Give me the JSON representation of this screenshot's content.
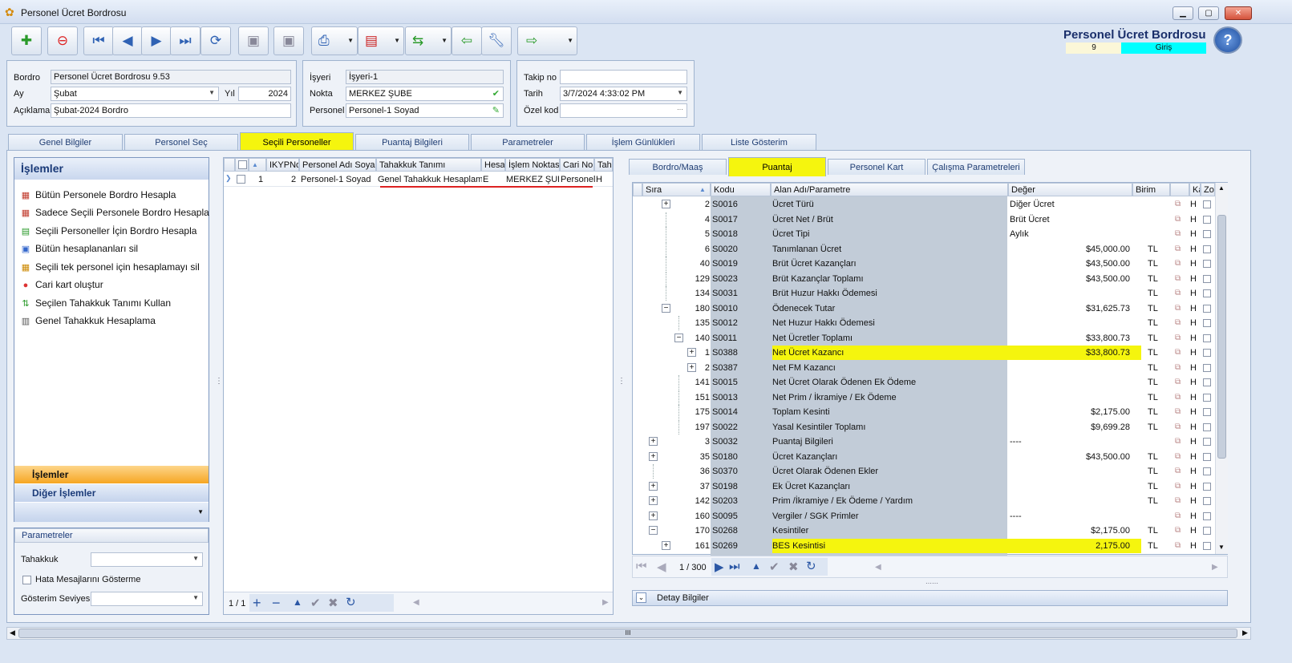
{
  "window": {
    "title": "Personel Ücret Bordrosu",
    "min": "▁",
    "max": "▢",
    "close": "✕"
  },
  "header": {
    "title": "Personel Ücret Bordrosu",
    "record_no": "9",
    "mode": "Giriş",
    "help": "?"
  },
  "colors": {
    "accent": "#f5f50e",
    "brand": "#1a2f6b",
    "mode_bg": "#00ffff"
  },
  "form": {
    "bordro_label": "Bordro",
    "bordro_value": "Personel Ücret Bordrosu 9.53",
    "ay_label": "Ay",
    "ay_value": "Şubat",
    "yil_label": "Yıl",
    "yil_value": "2024",
    "aciklama_label": "Açıklama",
    "aciklama_value": "Şubat-2024 Bordro",
    "isyeri_label": "İşyeri",
    "isyeri_value": "İşyeri-1",
    "nokta_label": "Nokta",
    "nokta_value": "MERKEZ ŞUBE",
    "personel_label": "Personel",
    "personel_value": "Personel-1 Soyad",
    "takip_label": "Takip no",
    "takip_value": "",
    "tarih_label": "Tarih",
    "tarih_value": "3/7/2024 4:33:02 PM",
    "ozel_label": "Özel kod",
    "ozel_value": "",
    "ellipsis": "···"
  },
  "tabs": [
    "Genel Bilgiler",
    "Personel Seç",
    "Seçili Personeller",
    "Puantaj Bilgileri",
    "Parametreler",
    "İşlem Günlükleri",
    "Liste Gösterim"
  ],
  "ops": {
    "title": "İşlemler",
    "items": [
      "Bütün Personele Bordro Hesapla",
      "Sadece Seçili Personele Bordro Hesapla",
      "Seçili Personeller İçin Bordro Hesapla",
      "Bütün hesaplananları sil",
      "Seçili tek personel için hesaplamayı sil",
      "Cari kart oluştur",
      "Seçilen Tahakkuk Tanımı Kullan",
      "Genel Tahakkuk Hesaplama"
    ],
    "group_active": "İşlemler",
    "group_other": "Diğer İşlemler",
    "params_title": "Parametreler",
    "tahakkuk_label": "Tahakkuk",
    "hata_label": "Hata Mesajlarını Gösterme",
    "gosterim_label": "Gösterim Seviyesi"
  },
  "grid": {
    "columns": [
      "IKYPNo",
      "Personel Adı Soyadı",
      "Tahakkuk Tanımı",
      "Hesap",
      "İşlem Noktası",
      "Cari No",
      "Tah"
    ],
    "row": {
      "idx": "1",
      "ikyp": "2",
      "name": "Personel-1 Soyad",
      "tanim": "Genel Tahakkuk Hesaplama",
      "hesap": "E",
      "nokta": "MERKEZ ŞUBE",
      "cari": "Personel",
      "tah": "H"
    },
    "pager": "1 / 1"
  },
  "subtabs": [
    "Bordro/Maaş",
    "Puantaj",
    "Personel Kart",
    "Çalışma Parametreleri"
  ],
  "tree": {
    "columns": [
      "Sıra",
      "Kodu",
      "Alan Adı/Parametre",
      "Değer",
      "Birim",
      "Ka",
      "Zor"
    ],
    "rows": [
      {
        "exp": "+",
        "sira": "2",
        "kod": "S0016",
        "ad": "Ücret Türü",
        "deger": "Diğer Ücret",
        "birim": "",
        "h": "H",
        "lvl": 1
      },
      {
        "exp": "",
        "sira": "4",
        "kod": "S0017",
        "ad": "Ücret Net / Brüt",
        "deger": "Brüt Ücret",
        "birim": "",
        "h": "H",
        "lvl": 1
      },
      {
        "exp": "",
        "sira": "5",
        "kod": "S0018",
        "ad": "Ücret Tipi",
        "deger": "Aylık",
        "birim": "",
        "h": "H",
        "lvl": 1
      },
      {
        "exp": "",
        "sira": "6",
        "kod": "S0020",
        "ad": "Tanımlanan Ücret",
        "deger": "$45,000.00",
        "birim": "TL",
        "h": "H",
        "lvl": 1
      },
      {
        "exp": "",
        "sira": "40",
        "kod": "S0019",
        "ad": "Brüt Ücret Kazançları",
        "deger": "$43,500.00",
        "birim": "TL",
        "h": "H",
        "lvl": 1
      },
      {
        "exp": "",
        "sira": "129",
        "kod": "S0023",
        "ad": "Brüt Kazançlar Toplamı",
        "deger": "$43,500.00",
        "birim": "TL",
        "h": "H",
        "lvl": 1
      },
      {
        "exp": "",
        "sira": "134",
        "kod": "S0031",
        "ad": "Brüt Huzur Hakkı Ödemesi",
        "deger": "",
        "birim": "TL",
        "h": "H",
        "lvl": 1
      },
      {
        "exp": "−",
        "sira": "180",
        "kod": "S0010",
        "ad": "Ödenecek Tutar",
        "deger": "$31,625.73",
        "birim": "TL",
        "h": "H",
        "lvl": 1
      },
      {
        "exp": "",
        "sira": "135",
        "kod": "S0012",
        "ad": "Net Huzur Hakkı Ödemesi",
        "deger": "",
        "birim": "TL",
        "h": "H",
        "lvl": 2
      },
      {
        "exp": "−",
        "sira": "140",
        "kod": "S0011",
        "ad": "Net Ücretler Toplamı",
        "deger": "$33,800.73",
        "birim": "TL",
        "h": "H",
        "lvl": 2
      },
      {
        "exp": "+",
        "sira": "1",
        "kod": "S0388",
        "ad": "Net Ücret Kazancı",
        "deger": "$33,800.73",
        "birim": "TL",
        "h": "H",
        "lvl": 3,
        "hl": true
      },
      {
        "exp": "+",
        "sira": "2",
        "kod": "S0387",
        "ad": "Net FM Kazancı",
        "deger": "",
        "birim": "TL",
        "h": "H",
        "lvl": 3
      },
      {
        "exp": "",
        "sira": "141",
        "kod": "S0015",
        "ad": "Net Ücret Olarak Ödenen Ek Ödeme",
        "deger": "",
        "birim": "TL",
        "h": "H",
        "lvl": 2
      },
      {
        "exp": "",
        "sira": "151",
        "kod": "S0013",
        "ad": "Net Prim / İkramiye / Ek Ödeme",
        "deger": "",
        "birim": "TL",
        "h": "H",
        "lvl": 2
      },
      {
        "exp": "",
        "sira": "175",
        "kod": "S0014",
        "ad": "Toplam Kesinti",
        "deger": "$2,175.00",
        "birim": "TL",
        "h": "H",
        "lvl": 2
      },
      {
        "exp": "",
        "sira": "197",
        "kod": "S0022",
        "ad": "Yasal Kesintiler Toplamı",
        "deger": "$9,699.28",
        "birim": "TL",
        "h": "H",
        "lvl": 2
      },
      {
        "exp": "+",
        "sira": "3",
        "kod": "S0032",
        "ad": "Puantaj Bilgileri",
        "deger": "----",
        "birim": "",
        "h": "H",
        "lvl": 0
      },
      {
        "exp": "+",
        "sira": "35",
        "kod": "S0180",
        "ad": "Ücret Kazançları",
        "deger": "$43,500.00",
        "birim": "TL",
        "h": "H",
        "lvl": 0
      },
      {
        "exp": "",
        "sira": "36",
        "kod": "S0370",
        "ad": "Ücret Olarak Ödenen Ekler",
        "deger": "",
        "birim": "TL",
        "h": "H",
        "lvl": 0
      },
      {
        "exp": "+",
        "sira": "37",
        "kod": "S0198",
        "ad": "Ek Ücret Kazançları",
        "deger": "",
        "birim": "TL",
        "h": "H",
        "lvl": 0
      },
      {
        "exp": "+",
        "sira": "142",
        "kod": "S0203",
        "ad": "Prim /İkramiye / Ek Ödeme / Yardım",
        "deger": "",
        "birim": "TL",
        "h": "H",
        "lvl": 0
      },
      {
        "exp": "+",
        "sira": "160",
        "kod": "S0095",
        "ad": "Vergiler / SGK Primler",
        "deger": "----",
        "birim": "",
        "h": "H",
        "lvl": 0
      },
      {
        "exp": "−",
        "sira": "170",
        "kod": "S0268",
        "ad": "Kesintiler",
        "deger": "$2,175.00",
        "birim": "TL",
        "h": "H",
        "lvl": 0
      },
      {
        "exp": "+",
        "sira": "161",
        "kod": "S0269",
        "ad": "BES Kesintisi",
        "deger": "2,175.00",
        "birim": "TL",
        "h": "H",
        "lvl": 1,
        "hl": true
      }
    ],
    "pager": "1 / 300",
    "detay": "Detay Bilgiler"
  },
  "hscroll": "III"
}
